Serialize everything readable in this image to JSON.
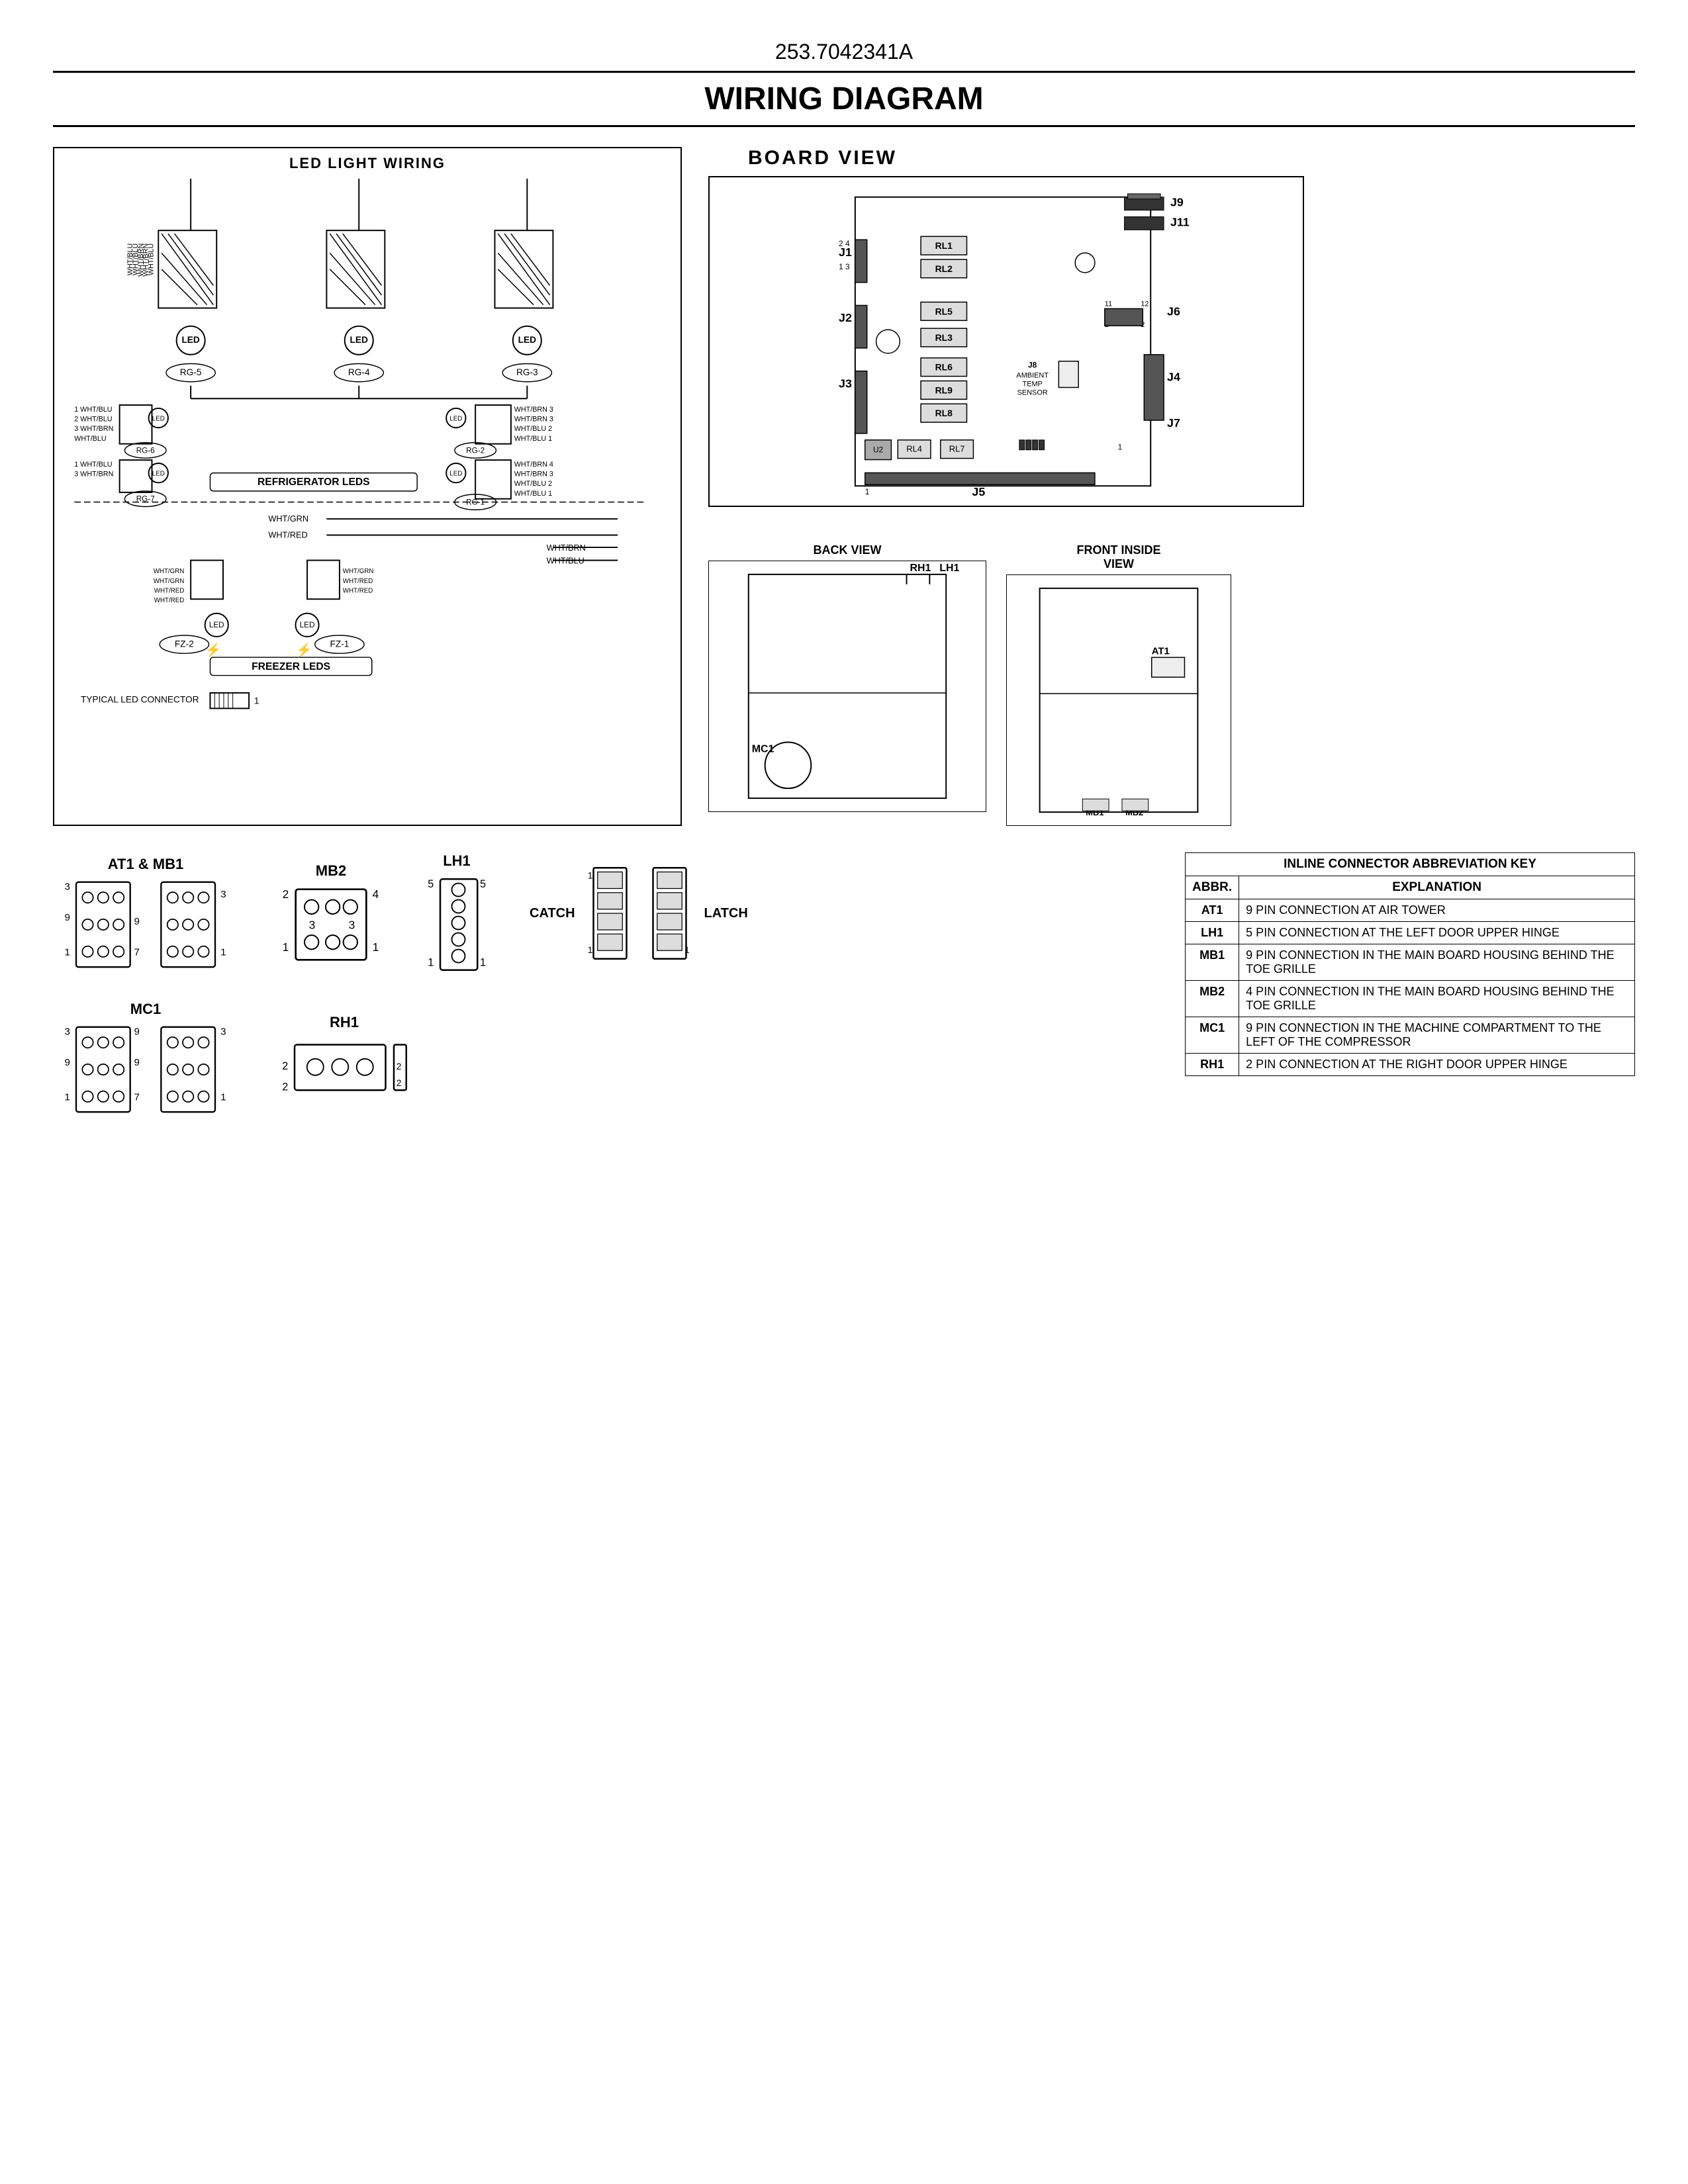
{
  "document": {
    "number": "253.7042341A",
    "title": "WIRING DIAGRAM"
  },
  "led_wiring": {
    "title": "LED LIGHT WIRING",
    "refrigerator_label": "REFRIGERATOR LEDS",
    "freezer_label": "FREEZER LEDS",
    "connector_label": "TYPICAL LED CONNECTOR",
    "components": [
      "RG-5",
      "RG-4",
      "RG-3",
      "RG-6",
      "RG-2",
      "RG-7",
      "RG-1",
      "FZ-2",
      "FZ-1"
    ]
  },
  "board_view": {
    "title": "BOARD VIEW",
    "connectors": [
      "J1",
      "J2",
      "J3",
      "J4",
      "J5",
      "J6",
      "J7",
      "J8",
      "J9",
      "J11"
    ],
    "relays": [
      "RL1",
      "RL2",
      "RL3",
      "RL4",
      "RL5",
      "RL6",
      "RL7",
      "RL8",
      "RL9"
    ],
    "j8_label": "J8 AMBIENT TEMP SENSOR"
  },
  "abbreviation_table": {
    "title": "INLINE CONNECTOR ABBREVIATION KEY",
    "headers": [
      "ABBR.",
      "EXPLANATION"
    ],
    "rows": [
      {
        "abbr": "AT1",
        "explanation": "9 PIN CONNECTION AT AIR TOWER"
      },
      {
        "abbr": "LH1",
        "explanation": "5 PIN CONNECTION AT THE LEFT DOOR UPPER HINGE"
      },
      {
        "abbr": "MB1",
        "explanation": "9 PIN CONNECTION IN THE MAIN BOARD HOUSING BEHIND THE TOE GRILLE"
      },
      {
        "abbr": "MB2",
        "explanation": "4 PIN CONNECTION IN THE MAIN BOARD HOUSING BEHIND THE TOE GRILLE"
      },
      {
        "abbr": "MC1",
        "explanation": "9 PIN CONNECTION IN THE MACHINE COMPARTMENT TO THE LEFT OF THE COMPRESSOR"
      },
      {
        "abbr": "RH1",
        "explanation": "2 PIN CONNECTION AT THE RIGHT DOOR UPPER HINGE"
      }
    ]
  },
  "connectors": {
    "at1_mb1": {
      "label": "AT1 & MB1"
    },
    "mb2": {
      "label": "MB2"
    },
    "lh1": {
      "label": "LH1"
    },
    "catch": {
      "label": "CATCH"
    },
    "latch": {
      "label": "LATCH"
    },
    "mc1": {
      "label": "MC1"
    },
    "rh1": {
      "label": "RH1"
    }
  },
  "views": {
    "back_label": "BACK VIEW",
    "front_inside_label": "FRONT INSIDE\nVIEW",
    "components": {
      "rh1": "RH1",
      "lh1": "LH1",
      "mc1": "MC1",
      "at1": "AT1",
      "mb1": "MB1",
      "mb2": "MB2"
    }
  }
}
